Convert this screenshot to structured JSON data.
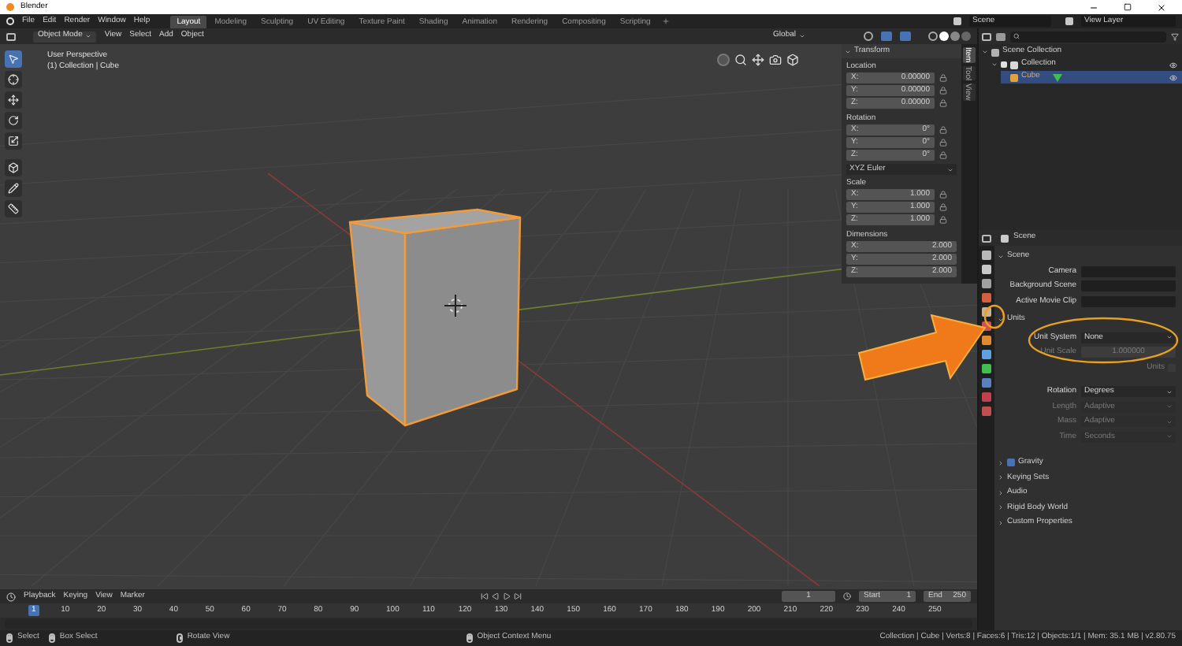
{
  "window": {
    "title": "Blender"
  },
  "menu": [
    "File",
    "Edit",
    "Render",
    "Window",
    "Help"
  ],
  "workspaces": [
    {
      "label": "Layout",
      "selected": true
    },
    {
      "label": "Modeling",
      "selected": false
    },
    {
      "label": "Sculpting",
      "selected": false
    },
    {
      "label": "UV Editing",
      "selected": false
    },
    {
      "label": "Texture Paint",
      "selected": false
    },
    {
      "label": "Shading",
      "selected": false
    },
    {
      "label": "Animation",
      "selected": false
    },
    {
      "label": "Rendering",
      "selected": false
    },
    {
      "label": "Compositing",
      "selected": false
    },
    {
      "label": "Scripting",
      "selected": false
    }
  ],
  "scene": "Scene",
  "view_layer": "View Layer",
  "viewport_header": {
    "mode": "Object Mode",
    "menus": [
      "View",
      "Select",
      "Add",
      "Object"
    ],
    "orientation": "Global"
  },
  "viewport": {
    "view_name": "User Perspective",
    "context": "(1) Collection | Cube"
  },
  "tools": [
    {
      "kind": "cursor",
      "selected": true
    },
    {
      "kind": "crosshair",
      "selected": false
    },
    {
      "kind": "move",
      "selected": false
    },
    {
      "kind": "rotate",
      "selected": false
    },
    {
      "kind": "scale",
      "selected": false
    },
    {
      "kind": "transform",
      "selected": false
    },
    {
      "kind": "annotate",
      "selected": false
    },
    {
      "kind": "measure",
      "selected": false
    }
  ],
  "n_panel": {
    "title": "Transform",
    "tabs": [
      {
        "label": "Item",
        "selected": true
      },
      {
        "label": "Tool",
        "selected": false
      },
      {
        "label": "View",
        "selected": false
      }
    ],
    "groups": [
      {
        "label": "Location",
        "lockable": true,
        "rows": [
          {
            "axis": "X:",
            "value": "0.00000"
          },
          {
            "axis": "Y:",
            "value": "0.00000"
          },
          {
            "axis": "Z:",
            "value": "0.00000"
          }
        ]
      },
      {
        "label": "Rotation",
        "lockable": true,
        "rotation_mode": "XYZ Euler",
        "rows": [
          {
            "axis": "X:",
            "value": "0°"
          },
          {
            "axis": "Y:",
            "value": "0°"
          },
          {
            "axis": "Z:",
            "value": "0°"
          }
        ]
      },
      {
        "label": "Scale",
        "lockable": true,
        "rows": [
          {
            "axis": "X:",
            "value": "1.000"
          },
          {
            "axis": "Y:",
            "value": "1.000"
          },
          {
            "axis": "Z:",
            "value": "1.000"
          }
        ]
      },
      {
        "label": "Dimensions",
        "lockable": false,
        "rows": [
          {
            "axis": "X:",
            "value": "2.000"
          },
          {
            "axis": "Y:",
            "value": "2.000"
          },
          {
            "axis": "Z:",
            "value": "2.000"
          }
        ]
      }
    ]
  },
  "outliner": {
    "tree": [
      {
        "label": "Scene Collection",
        "kind": "scene",
        "selected": false,
        "children": [
          {
            "label": "Collection",
            "kind": "collection",
            "selected": false,
            "checked": true,
            "visible": true,
            "children": [
              {
                "label": "Cube",
                "kind": "object",
                "selected": true,
                "visible": true
              }
            ]
          }
        ]
      }
    ]
  },
  "properties": {
    "context": "Scene",
    "sections": [
      {
        "title": "Scene",
        "kind": "panel",
        "expanded": true,
        "fields": [
          {
            "label": "Camera",
            "kind": "picker",
            "disabled": false
          },
          {
            "label": "Background Scene",
            "kind": "picker",
            "disabled": false
          },
          {
            "label": "Active Movie Clip",
            "kind": "picker",
            "disabled": false
          }
        ]
      },
      {
        "title": "Units",
        "kind": "panel",
        "expanded": true,
        "fields": [
          {
            "label": "Unit System",
            "kind": "dropdown",
            "value": "None",
            "disabled": false
          },
          {
            "label": "Unit Scale",
            "kind": "number",
            "value": "1.000000",
            "disabled": true
          },
          {
            "label": "Units",
            "kind": "checkbox",
            "checked": false,
            "disabled": true
          },
          {
            "label": "Rotation",
            "kind": "dropdown",
            "value": "Degrees",
            "disabled": false
          },
          {
            "label": "Length",
            "kind": "dropdown",
            "value": "Adaptive",
            "disabled": true
          },
          {
            "label": "Mass",
            "kind": "dropdown",
            "value": "Adaptive",
            "disabled": true
          },
          {
            "label": "Time",
            "kind": "dropdown",
            "value": "Seconds",
            "disabled": true
          }
        ]
      },
      {
        "title": "Gravity",
        "kind": "toggle",
        "expanded": false,
        "checked": true
      },
      {
        "title": "Keying Sets",
        "kind": "panel",
        "expanded": false
      },
      {
        "title": "Audio",
        "kind": "panel",
        "expanded": false
      },
      {
        "title": "Rigid Body World",
        "kind": "panel",
        "expanded": false
      },
      {
        "title": "Custom Properties",
        "kind": "panel",
        "expanded": false
      }
    ]
  },
  "timeline": {
    "menus": [
      "Playback",
      "Keying",
      "View",
      "Marker"
    ],
    "current_frame": "1",
    "start_label": "Start",
    "start": "1",
    "end_label": "End",
    "end": "250",
    "ticks": [
      "1",
      "10",
      "20",
      "30",
      "40",
      "50",
      "60",
      "70",
      "80",
      "90",
      "100",
      "110",
      "120",
      "130",
      "140",
      "150",
      "160",
      "170",
      "180",
      "190",
      "200",
      "210",
      "220",
      "230",
      "240",
      "250"
    ]
  },
  "status_bar": {
    "hints": [
      {
        "kind": "left",
        "label": "Select"
      },
      {
        "kind": "left",
        "label": "Box Select"
      },
      {
        "kind": "middle",
        "label": "Rotate View"
      },
      {
        "kind": "right",
        "label": "Object Context Menu"
      }
    ],
    "stats": "Collection | Cube | Verts:8 | Faces:6 | Tris:12 | Objects:1/1 | Mem: 35.1 MB | v2.80.75"
  }
}
